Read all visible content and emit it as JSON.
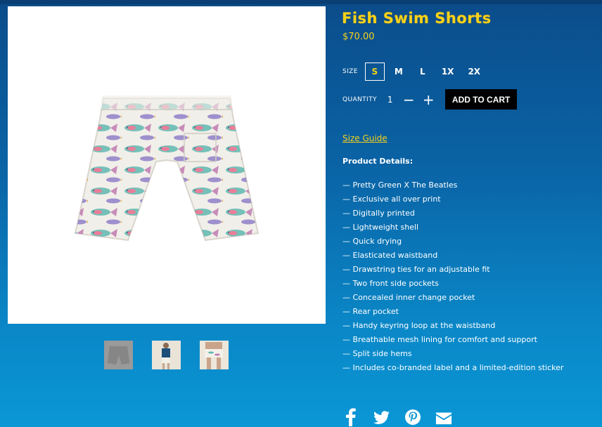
{
  "product": {
    "title": "Fish Swim Shorts",
    "price": "$70.00",
    "main_image": {
      "alt": "fish-print-swim-shorts-back"
    },
    "thumbnails": [
      {
        "label": "thumb-shorts-back"
      },
      {
        "label": "thumb-model-front"
      },
      {
        "label": "thumb-model-detail"
      }
    ]
  },
  "options": {
    "size_label": "SIZE",
    "sizes": [
      "S",
      "M",
      "L",
      "1X",
      "2X"
    ],
    "selected_size": "S",
    "quantity_label": "QUANTITY",
    "quantity_value": "1",
    "decrement": "−",
    "increment": "+",
    "add_to_cart": "ADD TO CART"
  },
  "size_guide": "Size Guide",
  "details": {
    "title": "Product Details:",
    "items": [
      "— Pretty Green X The Beatles",
      "— Exclusive all over print",
      "— Digitally printed",
      "— Lightweight shell",
      "— Quick drying",
      "— Elasticated waistband",
      "— Drawstring ties for an adjustable fit",
      "— Two front side pockets",
      "— Concealed inner change pocket",
      "— Rear pocket",
      "— Handy keyring loop at the waistband",
      "— Breathable mesh lining for comfort and support",
      "— Split side hems",
      "— Includes co-branded label and a limited-edition sticker"
    ]
  },
  "share_icons": [
    "facebook-icon",
    "twitter-icon",
    "pinterest-icon",
    "email-icon"
  ],
  "colors": {
    "accent": "#f7d21a",
    "background_top": "#0b4c8a",
    "background_bottom": "#0a97d6",
    "button": "#000000"
  }
}
